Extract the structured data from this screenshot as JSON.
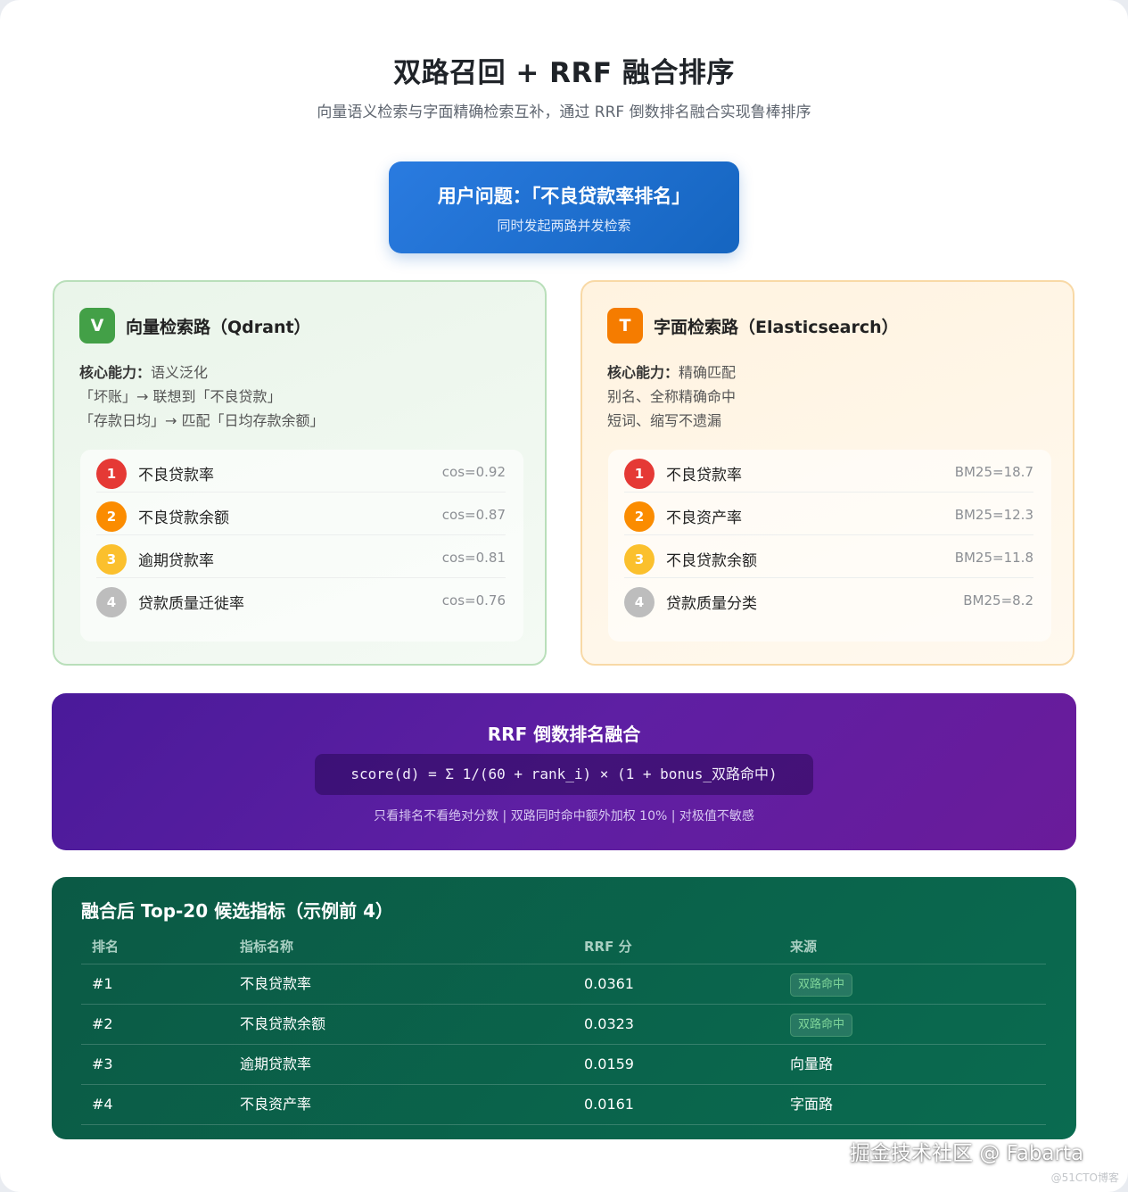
{
  "title": "双路召回 + RRF 融合排序",
  "subtitle": "向量语义检索与字面精确检索互补，通过 RRF 倒数排名融合实现鲁棒排序",
  "query": {
    "title": "用户问题：「不良贷款率排名」",
    "sub": "同时发起两路并发检索"
  },
  "vector_panel": {
    "badge": "V",
    "title": "向量检索路（Qdrant）",
    "ability_label": "核心能力：",
    "ability_value": "语义泛化",
    "notes": [
      "「坏账」→ 联想到「不良贷款」",
      "「存款日均」→ 匹配「日均存款余额」"
    ],
    "results": [
      {
        "rank": "1",
        "name": "不良贷款率",
        "score": "cos=0.92",
        "color": "#e53935"
      },
      {
        "rank": "2",
        "name": "不良贷款余额",
        "score": "cos=0.87",
        "color": "#fb8c00"
      },
      {
        "rank": "3",
        "name": "逾期贷款率",
        "score": "cos=0.81",
        "color": "#fbc02d"
      },
      {
        "rank": "4",
        "name": "贷款质量迁徙率",
        "score": "cos=0.76",
        "color": "#bdbdbd"
      }
    ]
  },
  "text_panel": {
    "badge": "T",
    "title": "字面检索路（Elasticsearch）",
    "ability_label": "核心能力：",
    "ability_value": "精确匹配",
    "notes": [
      "别名、全称精确命中",
      "短词、缩写不遗漏"
    ],
    "results": [
      {
        "rank": "1",
        "name": "不良贷款率",
        "score": "BM25=18.7",
        "color": "#e53935"
      },
      {
        "rank": "2",
        "name": "不良资产率",
        "score": "BM25=12.3",
        "color": "#fb8c00"
      },
      {
        "rank": "3",
        "name": "不良贷款余额",
        "score": "BM25=11.8",
        "color": "#fbc02d"
      },
      {
        "rank": "4",
        "name": "贷款质量分类",
        "score": "BM25=8.2",
        "color": "#bdbdbd"
      }
    ]
  },
  "rrf": {
    "title": "RRF 倒数排名融合",
    "formula": "score(d) = Σ 1/(60 + rank_i) × (1 + bonus_双路命中)",
    "note": "只看排名不看绝对分数 | 双路同时命中额外加权 10% | 对极值不敏感"
  },
  "top": {
    "title": "融合后 Top-20 候选指标（示例前 4）",
    "headers": [
      "排名",
      "指标名称",
      "RRF 分",
      "来源"
    ],
    "rows": [
      {
        "rank": "#1",
        "name": "不良贷款率",
        "score": "0.0361",
        "source": "双路命中",
        "tag": true
      },
      {
        "rank": "#2",
        "name": "不良贷款余额",
        "score": "0.0323",
        "source": "双路命中",
        "tag": true
      },
      {
        "rank": "#3",
        "name": "逾期贷款率",
        "score": "0.0159",
        "source": "向量路",
        "tag": false
      },
      {
        "rank": "#4",
        "name": "不良资产率",
        "score": "0.0161",
        "source": "字面路",
        "tag": false
      }
    ]
  },
  "watermark": "掘金技术社区 @ Fabarta",
  "watermark2": "@51CTO博客"
}
